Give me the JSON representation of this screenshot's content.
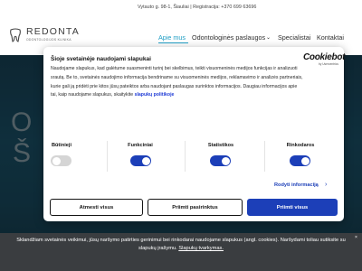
{
  "topbar": {
    "info": "Vytauto g. 98-1, Šiauliai | Registracija: +370 699 63696"
  },
  "header": {
    "logo_name": "REDONTA",
    "logo_sub": "ODONTOLOGIJOS KLINIKA",
    "nav": [
      {
        "label": "Apie mus",
        "active": true
      },
      {
        "label": "Odontologinės paslaugos"
      },
      {
        "label": "Specialistai"
      },
      {
        "label": "Kontaktai"
      }
    ]
  },
  "hero": {
    "ghost_1": "O",
    "ghost_2": "Š"
  },
  "consent": {
    "title": "Šioje svetainėje naudojami slapukai",
    "brand": "Cookiebot",
    "brand_by": "by Usercentrics",
    "body_line_1": "Naudojame slapukus, kad galėtume suasmeninti turinį bei skelbimus, teikti visuomeninės medijos funkcijas ir analizuoti",
    "body_line_2": "srautą. Be to, svetainės naudojimo informacija bendriname su visuomeninės medijos, reklamavimo ir analizės partneriais,",
    "body_line_3": "kurie gali ją pridėti prie kitos jūsų pateiktos arba naudojant paslaugas surinktos informacijos. Daugiau informacijos apie",
    "body_line_4": "tai, kaip naudojame slapukus, skaitykite",
    "policy_link": "slapukų politikoje",
    "toggles": [
      {
        "label": "Būtinieji",
        "on": false
      },
      {
        "label": "Funkciniai",
        "on": true
      },
      {
        "label": "Statistikos",
        "on": true
      },
      {
        "label": "Rinkodaros",
        "on": true
      }
    ],
    "details": "Rodyti informaciją",
    "btn_deny": "Atmesti visus",
    "btn_select": "Priimti pasirinktus",
    "btn_all": "Priimti visus",
    "colors": {
      "accent": "#1c3fb8",
      "nav_active": "#1f9ec4"
    }
  },
  "banner": {
    "line_1": "Sklandžiam svetainės veikimui, jūsų naršymo patirties gerinimui bei rinkodarai naudojame slapukus (angl. cookies). Naršydami toliau sutiksite su",
    "line_2a": "slapukų įrašymu.",
    "link": "Slapukų tvarkymas.",
    "close": "×"
  }
}
